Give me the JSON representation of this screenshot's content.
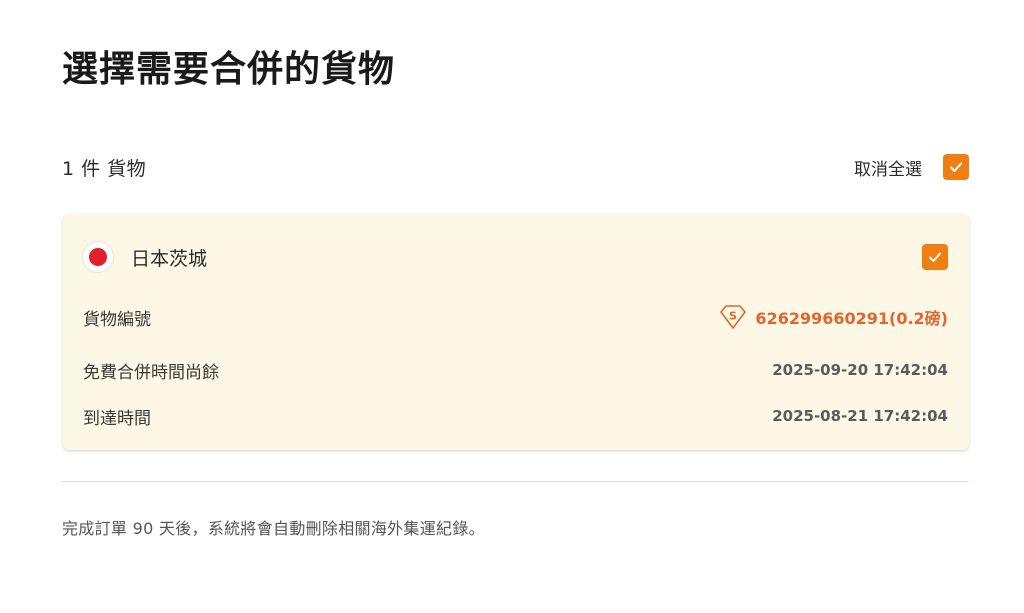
{
  "header": {
    "title": "選擇需要合併的貨物"
  },
  "summary": {
    "count_label": "1 件 貨物",
    "select_all_label": "取消全選",
    "select_all_checked": true
  },
  "card": {
    "origin": "日本茨城",
    "flag_icon": "japan-flag-icon",
    "checked": true,
    "tracking_label": "貨物編號",
    "tracking_icon": "super-badge-icon",
    "tracking_value": "626299660291(0.2磅)",
    "free_merge_label": "免費合併時間尚餘",
    "free_merge_value": "2025-09-20 17:42:04",
    "arrival_label": "到達時間",
    "arrival_value": "2025-08-21 17:42:04"
  },
  "footer": {
    "note": "完成訂單 90 天後，系統將會自動刪除相關海外集運紀錄。"
  },
  "colors": {
    "accent": "#f07f13",
    "card_background": "#fdf8e6",
    "tracking_text": "#e0662e",
    "flag_red": "#e2202c"
  }
}
